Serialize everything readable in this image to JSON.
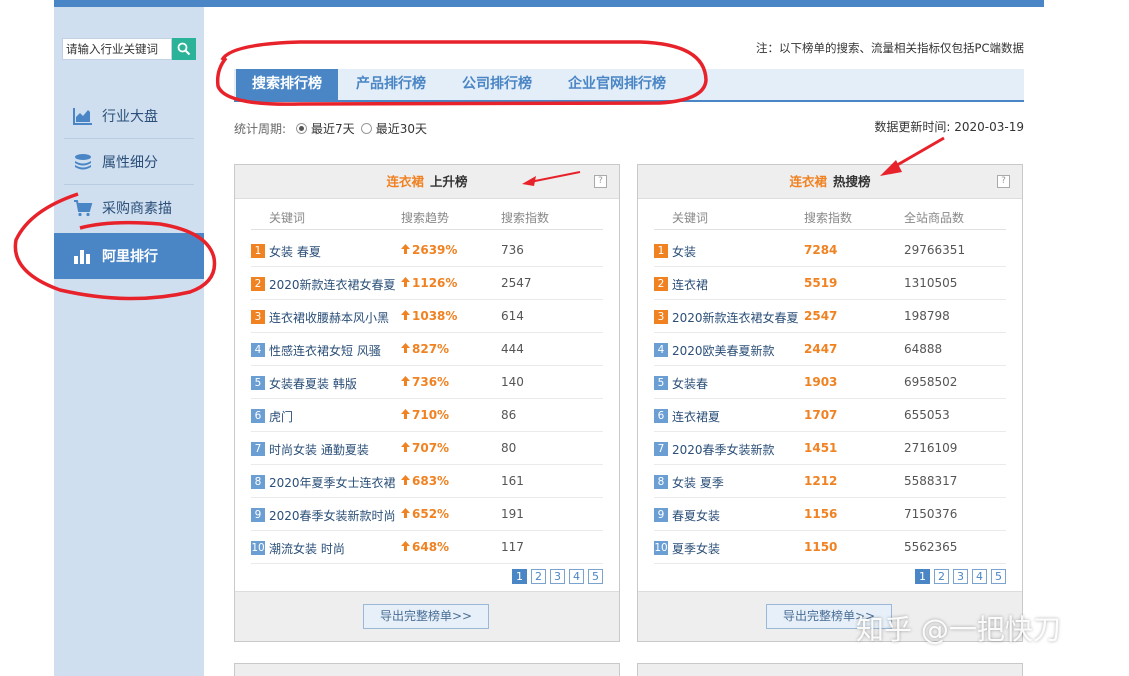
{
  "search": {
    "placeholder": "请输入行业关键词"
  },
  "sidebar": {
    "items": [
      {
        "label": "行业大盘",
        "icon": "area-chart-icon"
      },
      {
        "label": "属性细分",
        "icon": "layers-icon"
      },
      {
        "label": "采购商素描",
        "icon": "cart-icon"
      },
      {
        "label": "阿里排行",
        "icon": "bar-chart-icon",
        "active": true
      }
    ]
  },
  "note": "注：以下榜单的搜索、流量相关指标仅包括PC端数据",
  "tabs": [
    {
      "label": "搜索排行榜",
      "active": true
    },
    {
      "label": "产品排行榜"
    },
    {
      "label": "公司排行榜"
    },
    {
      "label": "企业官网排行榜"
    }
  ],
  "period": {
    "label": "统计周期:",
    "opt7": "最近7天",
    "opt30": "最近30天",
    "selected": "最近7天"
  },
  "update": {
    "label": "数据更新时间:",
    "date": "2020-03-19"
  },
  "panel_rise": {
    "category": "连衣裙",
    "title": "上升榜",
    "help": "?",
    "columns": [
      "关键词",
      "搜索趋势",
      "搜索指数"
    ],
    "rows": [
      {
        "rank": "1",
        "keyword": "女装 春夏",
        "trend": "2639%",
        "index": "736"
      },
      {
        "rank": "2",
        "keyword": "2020新款连衣裙女春夏",
        "trend": "1126%",
        "index": "2547"
      },
      {
        "rank": "3",
        "keyword": "连衣裙收腰赫本风小黑",
        "trend": "1038%",
        "index": "614"
      },
      {
        "rank": "4",
        "keyword": "性感连衣裙女短 风骚",
        "trend": "827%",
        "index": "444"
      },
      {
        "rank": "5",
        "keyword": "女装春夏装 韩版",
        "trend": "736%",
        "index": "140"
      },
      {
        "rank": "6",
        "keyword": "虎门",
        "trend": "710%",
        "index": "86"
      },
      {
        "rank": "7",
        "keyword": "时尚女装 通勤夏装",
        "trend": "707%",
        "index": "80"
      },
      {
        "rank": "8",
        "keyword": "2020年夏季女士连衣裙",
        "trend": "683%",
        "index": "161"
      },
      {
        "rank": "9",
        "keyword": "2020春季女装新款时尚",
        "trend": "652%",
        "index": "191"
      },
      {
        "rank": "10",
        "keyword": "潮流女装 时尚",
        "trend": "648%",
        "index": "117"
      }
    ],
    "pages": [
      "1",
      "2",
      "3",
      "4",
      "5"
    ],
    "export": "导出完整榜单>>"
  },
  "panel_hot": {
    "category": "连衣裙",
    "title": "热搜榜",
    "help": "?",
    "columns": [
      "关键词",
      "搜索指数",
      "全站商品数"
    ],
    "rows": [
      {
        "rank": "1",
        "keyword": "女装",
        "index": "7284",
        "count": "29766351"
      },
      {
        "rank": "2",
        "keyword": "连衣裙",
        "index": "5519",
        "count": "1310505"
      },
      {
        "rank": "3",
        "keyword": "2020新款连衣裙女春夏",
        "index": "2547",
        "count": "198798"
      },
      {
        "rank": "4",
        "keyword": "2020欧美春夏新款",
        "index": "2447",
        "count": "64888"
      },
      {
        "rank": "5",
        "keyword": "女装春",
        "index": "1903",
        "count": "6958502"
      },
      {
        "rank": "6",
        "keyword": "连衣裙夏",
        "index": "1707",
        "count": "655053"
      },
      {
        "rank": "7",
        "keyword": "2020春季女装新款",
        "index": "1451",
        "count": "2716109"
      },
      {
        "rank": "8",
        "keyword": "女装 夏季",
        "index": "1212",
        "count": "5588317"
      },
      {
        "rank": "9",
        "keyword": "春夏女装",
        "index": "1156",
        "count": "7150376"
      },
      {
        "rank": "10",
        "keyword": "夏季女装",
        "index": "1150",
        "count": "5562365"
      }
    ],
    "pages": [
      "1",
      "2",
      "3",
      "4",
      "5"
    ],
    "export": "导出完整榜单>>"
  },
  "watermark": "知乎 @一把快刀",
  "colors": {
    "accent": "#4a86c5",
    "orange": "#f08222",
    "annotation_red": "#e8222a",
    "sidebar_bg": "#cfdff0"
  }
}
